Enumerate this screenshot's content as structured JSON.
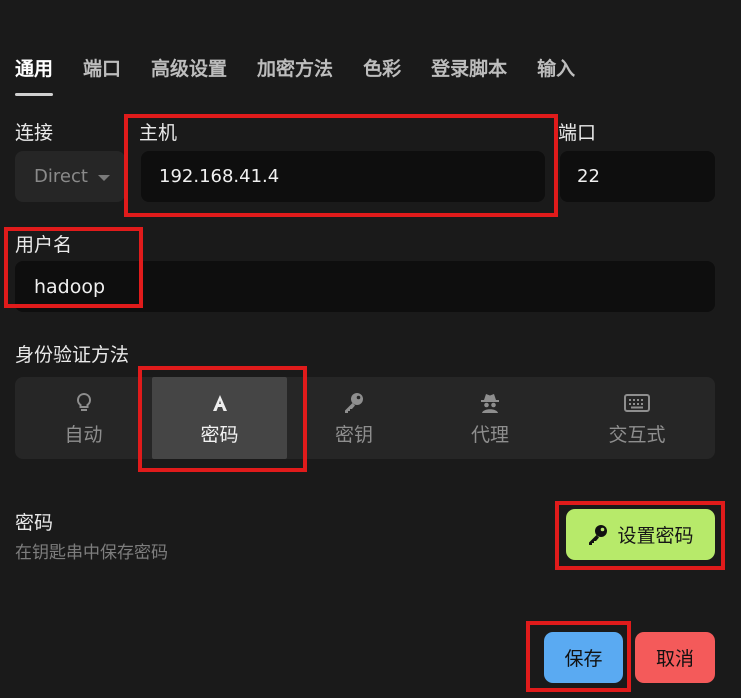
{
  "tabs": [
    {
      "label": "通用"
    },
    {
      "label": "端口"
    },
    {
      "label": "高级设置"
    },
    {
      "label": "加密方法"
    },
    {
      "label": "色彩"
    },
    {
      "label": "登录脚本"
    },
    {
      "label": "输入"
    }
  ],
  "connection": {
    "label": "连接",
    "value": "Direct"
  },
  "host": {
    "label": "主机",
    "value": "192.168.41.4"
  },
  "port": {
    "label": "端口",
    "value": "22"
  },
  "username": {
    "label": "用户名",
    "value": "hadoop"
  },
  "auth": {
    "label": "身份验证方法",
    "options": [
      {
        "label": "自动",
        "icon": "lightbulb-icon"
      },
      {
        "label": "密码",
        "icon": "text-a-icon",
        "selected": true
      },
      {
        "label": "密钥",
        "icon": "key-icon"
      },
      {
        "label": "代理",
        "icon": "agent-icon"
      },
      {
        "label": "交互式",
        "icon": "keyboard-icon"
      }
    ]
  },
  "password": {
    "title": "密码",
    "subtitle": "在钥匙串中保存密码",
    "set_button": "设置密码"
  },
  "actions": {
    "save": "保存",
    "cancel": "取消"
  },
  "colors": {
    "background": "#1a1a1a",
    "set_password": "#b7ea6a",
    "save": "#5aaaf2",
    "cancel": "#f45a5a",
    "highlight": "#e01b1b"
  }
}
